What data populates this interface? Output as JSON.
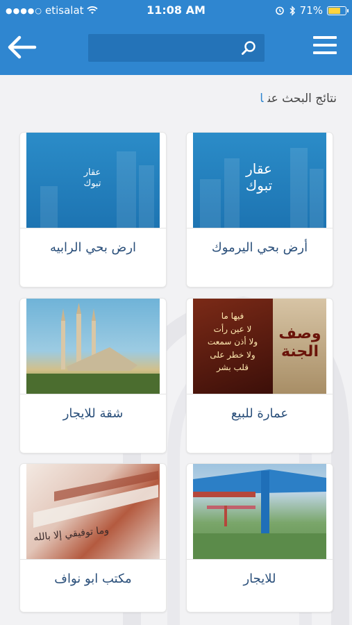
{
  "status_bar": {
    "carrier": "etisalat",
    "time": "11:08 AM",
    "battery_percent": "71%",
    "battery_level": 0.71,
    "signal_dots": "●●●●○"
  },
  "header": {
    "search": {
      "value": "",
      "placeholder": ""
    }
  },
  "results": {
    "title": "نتائج البحث عن",
    "query": "ا"
  },
  "listings": [
    {
      "label": "أرض بحي اليرموك",
      "image_text_1": "عقار",
      "image_text_2": "تبوك"
    },
    {
      "label": "ارض بحي الرابيه",
      "image_text_1": "عقار",
      "image_text_2": "تبوك"
    },
    {
      "label": "عمارة للبيع",
      "image_big_1": "وصف",
      "image_big_2": "الجنة",
      "image_lines": [
        "فيها ما",
        "لا عين رأت",
        "ولا أذن سمعت",
        "ولا خطر على",
        "قلب بشر"
      ]
    },
    {
      "label": "شقة للايجار"
    },
    {
      "label": "للايجار"
    },
    {
      "label": "مكتب ابو نواف",
      "image_text": "وما توفيقي إلا بالله"
    }
  ],
  "colors": {
    "primary": "#2f86d0",
    "search_bg": "#2473b8",
    "label_text": "#2a4f7a",
    "battery": "#ffd33d"
  }
}
